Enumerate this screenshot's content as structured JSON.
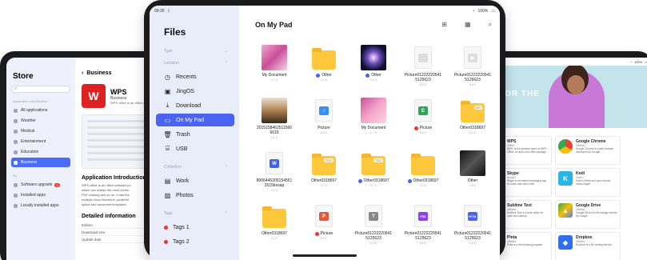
{
  "left_store": {
    "title": "Store",
    "category_header": "Application classification",
    "items": [
      {
        "label": "All applications"
      },
      {
        "label": "Weather"
      },
      {
        "label": "Medical"
      },
      {
        "label": "Entertainment"
      },
      {
        "label": "Education"
      },
      {
        "label": "Business"
      }
    ],
    "my_header": "My",
    "my_items": [
      {
        "label": "Software upgrade",
        "badge": "8"
      },
      {
        "label": "Installed apps"
      },
      {
        "label": "Locally installed apps"
      }
    ],
    "back_label": "Business",
    "app_name": "WPS",
    "app_category": "Business",
    "app_desc": "WPS office is an office software",
    "intro_title": "Application Introduction",
    "intro_text_1": "WPS office is an office software po",
    "intro_text_2": "which can realize the most comm",
    "intro_text_3": "PDF reading and so on. It has the",
    "intro_text_4": "multiple cloud functions, powerful",
    "intro_text_5": "space and document templates",
    "detail_title": "Detailed information",
    "details": [
      {
        "k": "Edition",
        "v": "11.1.0.10"
      },
      {
        "k": "Download size",
        "v": "305M"
      },
      {
        "k": "Update date",
        "v": "2021.09"
      }
    ]
  },
  "center_files": {
    "status_time": "09:30",
    "status_battery": "100%",
    "title": "Files",
    "type_header": "Type",
    "location_header": "Location",
    "locations": [
      {
        "label": "Recents"
      },
      {
        "label": "JingOS"
      },
      {
        "label": "Download"
      },
      {
        "label": "On My Pad"
      },
      {
        "label": "Trash"
      },
      {
        "label": "USB"
      }
    ],
    "collection_header": "Collection",
    "collections": [
      {
        "label": "Work"
      },
      {
        "label": "Photos"
      }
    ],
    "tags_header": "Tags",
    "tags": [
      {
        "label": "Tags 1"
      },
      {
        "label": "Tags 2"
      }
    ],
    "main_title": "On My Pad",
    "files": [
      {
        "name": "My Document",
        "meta": "1.7 K",
        "kind": "photo-pink"
      },
      {
        "name": "Other",
        "meta": "4.9 K",
        "kind": "folder",
        "dot": "#4a63f0"
      },
      {
        "name": "Other",
        "meta": "4.9 K",
        "kind": "photo-galaxy",
        "dot": "#4a63f0"
      },
      {
        "name": "Picture01222220541",
        "name2": "5125623",
        "meta": "8.5 K",
        "kind": "doc-blank"
      },
      {
        "name": "Picture01222220541",
        "name2": "5125623",
        "meta": "8.5 K",
        "kind": "doc-video"
      },
      {
        "name": "2015158462511566",
        "name2": "6619",
        "meta": "2.1 K",
        "kind": "photo-portrait"
      },
      {
        "name": "Picture",
        "meta": "8.5 K",
        "kind": "doc-music"
      },
      {
        "name": "My Document",
        "meta": "1.7 K",
        "kind": "photo-pink2"
      },
      {
        "name": "Picture",
        "meta": "8.5 K",
        "kind": "doc-excel",
        "dot": "#e33"
      },
      {
        "name": "Other0318697",
        "meta": "2.1 K",
        "kind": "folder-zip"
      },
      {
        "name": "8006445205154551",
        "name2": "2515kxoap",
        "meta": "2.1 K",
        "kind": "doc-word"
      },
      {
        "name": "Other0318697",
        "meta": "2.1 K",
        "kind": "folder-tgz"
      },
      {
        "name": "Other0318697",
        "meta": "2.1 K",
        "kind": "folder-tgz2",
        "dot": "#4a63f0"
      },
      {
        "name": "Other0318697",
        "meta": "2.1 K",
        "kind": "folder",
        "dot": "#4a63f0"
      },
      {
        "name": "Other",
        "meta": "4.9 K",
        "kind": "photo-dark"
      },
      {
        "name": "Other0318697",
        "meta": "2.1 K",
        "kind": "folder"
      },
      {
        "name": "Picture",
        "meta": "8.5 K",
        "kind": "doc-ppt",
        "dot": "#e33"
      },
      {
        "name": "Picture01222220541",
        "name2": "5125623",
        "meta": "8.5 K",
        "kind": "doc-gray"
      },
      {
        "name": "Picture01222220541",
        "name2": "5125623",
        "meta": "8.5 K",
        "kind": "doc-psd"
      },
      {
        "name": "Picture01222220541",
        "name2": "5125623",
        "meta": "8.5 K",
        "kind": "doc-html"
      }
    ]
  },
  "right_store": {
    "status_battery": "100%",
    "banner_text": "R FOR THE",
    "apps": [
      {
        "name": "WPS",
        "sub": "Office",
        "desc": "WPS, is the shortcut name of WPS Office, an all-in-one office package",
        "color": "#d22",
        "glyph": "W"
      },
      {
        "name": "Google Chrome",
        "sub": "Utilities",
        "desc": "Google Chrome is a web browser developed by Google",
        "color": "#ffffff",
        "glyph": "◉"
      },
      {
        "name": "Skype",
        "sub": "Social",
        "desc": "Skype is an instant messaging app for voice and video calls",
        "color": "#1ea7e8",
        "glyph": "S"
      },
      {
        "name": "Kodi",
        "sub": "Video",
        "desc": "Kodi is a free and open source media player",
        "color": "#2bb5e6",
        "glyph": "K"
      },
      {
        "name": "Sublime Text",
        "sub": "Utilities",
        "desc": "Sublime Text is a code editor for code and markup",
        "color": "#ff9a1a",
        "glyph": "S"
      },
      {
        "name": "Google Drive",
        "sub": "Utilities",
        "desc": "Google Drive is a file storage service by Google",
        "color": "#ffffff",
        "glyph": "▲"
      },
      {
        "name": "Pinta",
        "sub": "Utilities",
        "desc": "Pinta is a free drawing program",
        "color": "#e84a4a",
        "glyph": "P"
      },
      {
        "name": "Dropbox",
        "sub": "Utilities",
        "desc": "Dropbox is a file hosting service",
        "color": "#2f6ff0",
        "glyph": "◆"
      }
    ]
  }
}
